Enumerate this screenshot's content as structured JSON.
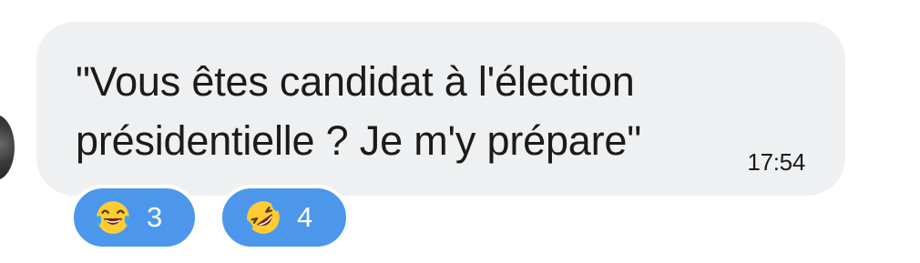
{
  "message": {
    "line1": "\"Vous êtes candidat à l'élection",
    "line2": "présidentielle ? Je m'y prépare\"",
    "time": "17:54"
  },
  "reactions": [
    {
      "icon": "tears-of-joy-emoji-icon",
      "count": "3"
    },
    {
      "icon": "rolling-on-floor-laughing-emoji-icon",
      "count": "4"
    }
  ],
  "colors": {
    "bubble": "#eef0f2",
    "reaction_chip": "#4c97ec",
    "text": "#1b1b1b"
  }
}
